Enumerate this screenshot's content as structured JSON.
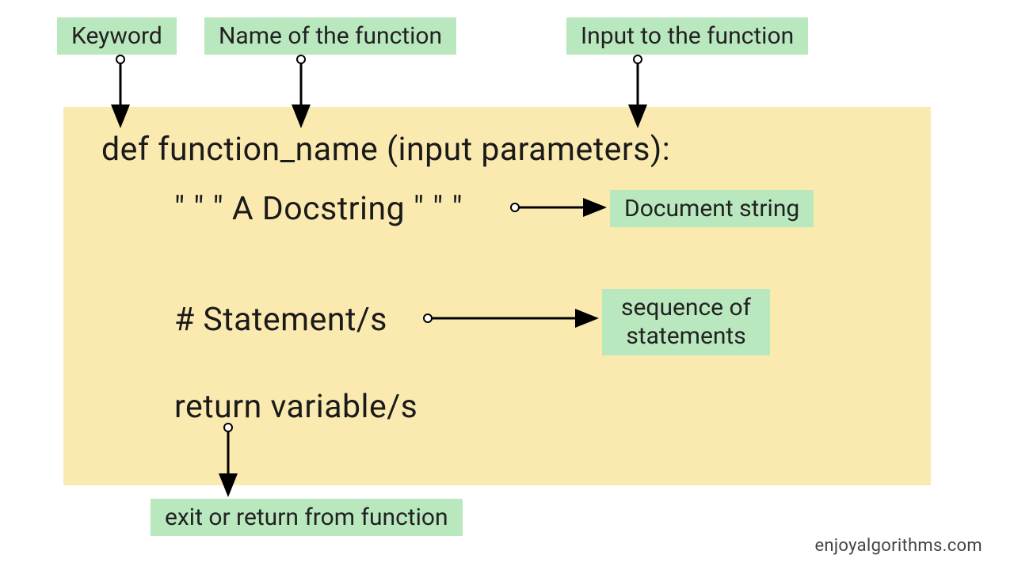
{
  "labels": {
    "keyword": "Keyword",
    "func_name": "Name of the function",
    "input": "Input to the function",
    "docstring": "Document string",
    "statements_line1": "sequence of",
    "statements_line2": "statements",
    "return": "exit or return from function"
  },
  "code": {
    "def_line": "def  function_name (input parameters):",
    "docstring_line": "\" \" \" A Docstring \" \" \"",
    "statement_line": "# Statement/s",
    "return_line": "return    variable/s"
  },
  "watermark": "enjoyalgorithms.com"
}
